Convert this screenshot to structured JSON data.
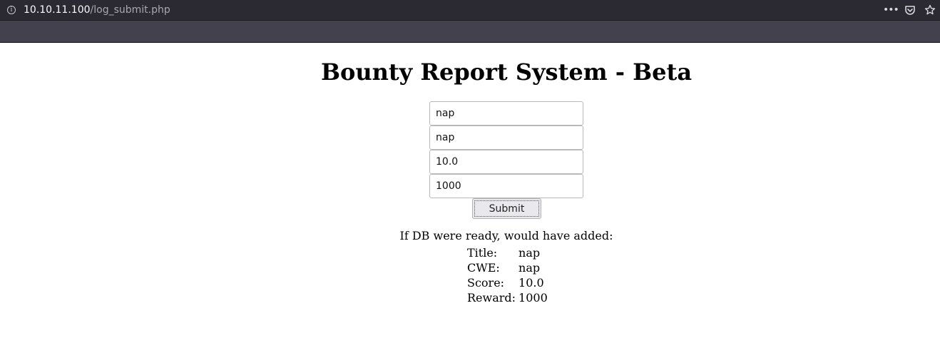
{
  "browser": {
    "url_host": "10.10.11.100",
    "url_path": "/log_submit.php",
    "info_icon": "info-icon",
    "menu_icon": "more-horizontal-icon",
    "pocket_icon": "pocket-icon",
    "bookmark_icon": "star-icon"
  },
  "page": {
    "title": "Bounty Report System - Beta",
    "form": {
      "title_value": "nap",
      "cwe_value": "nap",
      "score_value": "10.0",
      "reward_value": "1000",
      "submit_label": "Submit"
    },
    "result": {
      "heading": "If DB were ready, would have added:",
      "rows": [
        {
          "label": "Title:",
          "value": "nap"
        },
        {
          "label": "CWE:",
          "value": "nap"
        },
        {
          "label": "Score:",
          "value": "10.0"
        },
        {
          "label": "Reward:",
          "value": "1000"
        }
      ]
    }
  }
}
